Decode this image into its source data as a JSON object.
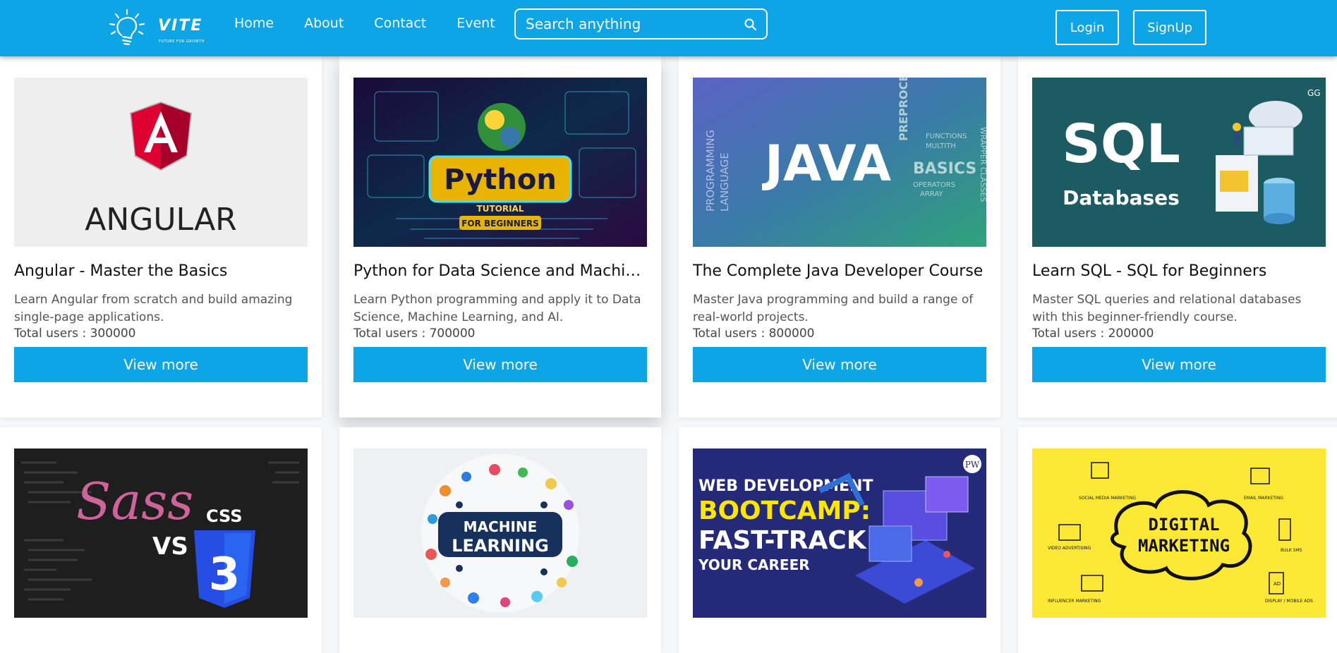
{
  "nav": {
    "logo_text": "VITE",
    "logo_tagline": "FUTURE FOR GROWTH",
    "links": [
      "Home",
      "About",
      "Contact",
      "Event"
    ],
    "search_placeholder": "Search anything",
    "login": "Login",
    "signup": "SignUp"
  },
  "users_prefix": "Total users : ",
  "button_label": "View more",
  "courses": [
    {
      "title": "Angular - Master the Basics",
      "desc": "Learn Angular from scratch and build amazing single-page applications.",
      "users": "300000",
      "image_text": "ANGULAR"
    },
    {
      "title": "Python for Data Science and Machine Learning",
      "desc": "Learn Python programming and apply it to Data Science, Machine Learning, and AI.",
      "users": "700000",
      "image_text": "Python",
      "image_sub1": "TUTORIAL",
      "image_sub2": "FOR BEGINNERS"
    },
    {
      "title": "The Complete Java Developer Course",
      "desc": "Master Java programming and build a range of real-world projects.",
      "users": "800000",
      "image_text": "JAVA",
      "image_sub1": "PROGRAMMING",
      "image_sub2": "LANGUAGE",
      "image_sub3": "BASICS",
      "image_sub4": "PREPROCE",
      "image_sub5": "OPERATORS",
      "image_sub6": "ARRAY",
      "image_sub7": "WRAPPER CLASSES",
      "image_sub8": "FUNCTIONS",
      "image_sub9": "MULTITH"
    },
    {
      "title": "Learn SQL - SQL for Beginners",
      "desc": "Master SQL queries and relational databases with this beginner-friendly course.",
      "users": "200000",
      "image_text": "SQL",
      "image_sub1": "Databases",
      "image_sub2": "GG"
    },
    {
      "image_text": "Sass",
      "image_sub1": "VS",
      "image_sub2": "CSS",
      "image_sub3": "3"
    },
    {
      "image_text": "MACHINE",
      "image_sub1": "LEARNING"
    },
    {
      "image_text": "WEB DEVELOPMENT",
      "image_sub1": "BOOTCAMP:",
      "image_sub2": "FAST-TRACK",
      "image_sub3": "YOUR CAREER",
      "image_sub4": "PW"
    },
    {
      "image_text": "DIGITAL",
      "image_sub1": "MARKETING",
      "image_sub2": "SOCIAL MEDIA MARKETING",
      "image_sub3": "EMAIL MARKETING",
      "image_sub4": "VIDEO ADVERTISING",
      "image_sub5": "BULK SMS",
      "image_sub6": "INFLUENCER MARKETING",
      "image_sub7": "DISPLAY / MOBILE ADS",
      "image_sub8": "AD"
    }
  ],
  "colors": {
    "brand": "#0ea5e6",
    "angular_red": "#c3002f",
    "sql_teal": "#1d5b63",
    "digital_yellow": "#fde935"
  }
}
